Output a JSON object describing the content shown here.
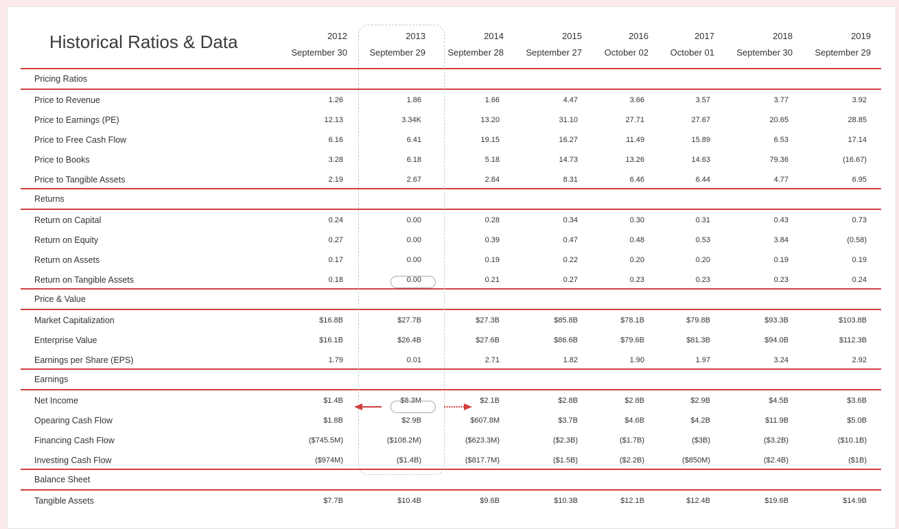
{
  "title": "Historical Ratios & Data",
  "accent_color": "#d0403f",
  "columns": [
    {
      "year": "2012",
      "date": "September 30"
    },
    {
      "year": "2013",
      "date": "September 29"
    },
    {
      "year": "2014",
      "date": "September 28"
    },
    {
      "year": "2015",
      "date": "September 27"
    },
    {
      "year": "2016",
      "date": "October 02"
    },
    {
      "year": "2017",
      "date": "October 01"
    },
    {
      "year": "2018",
      "date": "September 30"
    },
    {
      "year": "2019",
      "date": "September 29"
    }
  ],
  "sections": [
    {
      "name": "Pricing Ratios",
      "rows": [
        {
          "label": "Price to Revenue",
          "values": [
            "1.26",
            "1.86",
            "1.66",
            "4.47",
            "3.66",
            "3.57",
            "3.77",
            "3.92"
          ]
        },
        {
          "label": "Price to Earnings (PE)",
          "values": [
            "12.13",
            "3.34K",
            "13.20",
            "31.10",
            "27.71",
            "27.67",
            "20.65",
            "28.85"
          ]
        },
        {
          "label": "Price to Free Cash Flow",
          "values": [
            "6.16",
            "6.41",
            "19.15",
            "16.27",
            "11.49",
            "15.89",
            "6.53",
            "17.14"
          ]
        },
        {
          "label": "Price to Books",
          "values": [
            "3.28",
            "6.18",
            "5.18",
            "14.73",
            "13.26",
            "14.63",
            "79.36",
            "(16.67)"
          ]
        },
        {
          "label": "Price to Tangible Assets",
          "values": [
            "2.19",
            "2.67",
            "2.84",
            "8.31",
            "6.46",
            "6.44",
            "4.77",
            "6.95"
          ]
        }
      ]
    },
    {
      "name": "Returns",
      "rows": [
        {
          "label": "Return on Capital",
          "values": [
            "0.24",
            "0.00",
            "0.28",
            "0.34",
            "0.30",
            "0.31",
            "0.43",
            "0.73"
          ]
        },
        {
          "label": "Return on Equity",
          "values": [
            "0.27",
            "0.00",
            "0.39",
            "0.47",
            "0.48",
            "0.53",
            "3.84",
            "(0.58)"
          ]
        },
        {
          "label": "Return on Assets",
          "values": [
            "0.17",
            "0.00",
            "0.19",
            "0.22",
            "0.20",
            "0.20",
            "0.19",
            "0.19"
          ]
        },
        {
          "label": "Return on Tangible Assets",
          "values": [
            "0.18",
            "0.00",
            "0.21",
            "0.27",
            "0.23",
            "0.23",
            "0.23",
            "0.24"
          ]
        }
      ]
    },
    {
      "name": "Price & Value",
      "rows": [
        {
          "label": "Market Capitalization",
          "values": [
            "$16.8B",
            "$27.7B",
            "$27.3B",
            "$85.8B",
            "$78.1B",
            "$79.8B",
            "$93.3B",
            "$103.8B"
          ]
        },
        {
          "label": "Enterprise Value",
          "values": [
            "$16.1B",
            "$26.4B",
            "$27.6B",
            "$86.6B",
            "$79.6B",
            "$81.3B",
            "$94.0B",
            "$112.3B"
          ]
        },
        {
          "label": "Earnings per Share (EPS)",
          "values": [
            "1.79",
            "0.01",
            "2.71",
            "1.82",
            "1.90",
            "1.97",
            "3.24",
            "2.92"
          ]
        }
      ]
    },
    {
      "name": "Earnings",
      "rows": [
        {
          "label": "Net Income",
          "values": [
            "$1.4B",
            "$8.3M",
            "$2.1B",
            "$2.8B",
            "$2.8B",
            "$2.9B",
            "$4.5B",
            "$3.6B"
          ]
        },
        {
          "label": "Opearing Cash Flow",
          "values": [
            "$1.8B",
            "$2.9B",
            "$607.8M",
            "$3.7B",
            "$4.6B",
            "$4.2B",
            "$11.9B",
            "$5.0B"
          ]
        },
        {
          "label": "Financing Cash Flow",
          "values": [
            "($745.5M)",
            "($108.2M)",
            "($623.3M)",
            "($2.3B)",
            "($1.7B)",
            "($3B)",
            "($3.2B)",
            "($10.1B)"
          ]
        },
        {
          "label": "Investing Cash Flow",
          "values": [
            "($974M)",
            "($1.4B)",
            "($817.7M)",
            "($1.5B)",
            "($2.2B)",
            "($850M)",
            "($2.4B)",
            "($1B)"
          ]
        }
      ]
    },
    {
      "name": "Balance Sheet",
      "rows": [
        {
          "label": "Tangible Assets",
          "values": [
            "$7.7B",
            "$10.4B",
            "$9.6B",
            "$10.3B",
            "$12.1B",
            "$12.4B",
            "$19.6B",
            "$14.9B"
          ]
        }
      ]
    }
  ]
}
